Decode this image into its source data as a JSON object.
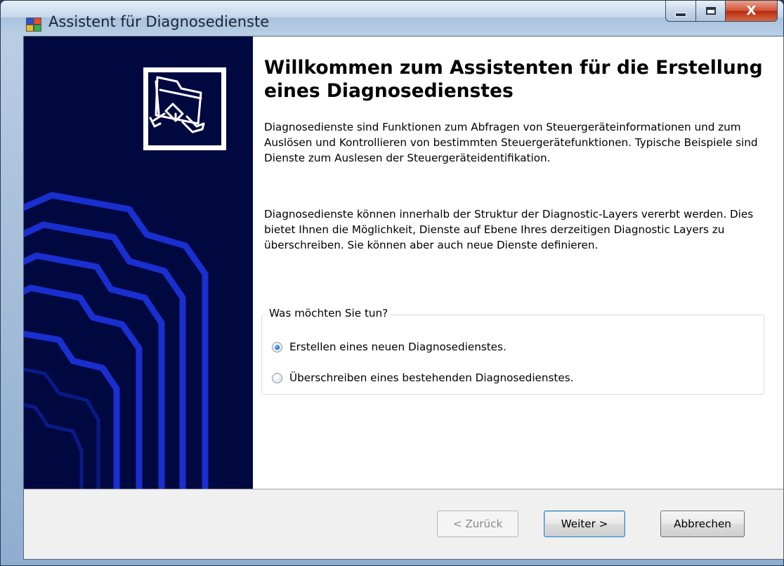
{
  "window": {
    "title": "Assistent für Diagnosedienste",
    "controls": {
      "minimize": "–",
      "maximize": "□",
      "close": "X"
    }
  },
  "banner": {
    "icon": "network-folder-icon",
    "accent_color": "#000840",
    "line_color": "#1a2fd0"
  },
  "content": {
    "heading": "Willkommen zum Assistenten für die Erstellung eines Diagnosedienstes",
    "paragraph1": "Diagnosedienste sind Funktionen zum Abfragen von Steuergeräteinformationen und zum Auslösen und Kontrollieren von bestimmten Steuergerätefunktionen. Typische Beispiele sind Dienste zum Auslesen der Steuergeräteidentifikation.",
    "paragraph2": "Diagnosedienste können innerhalb der Struktur der Diagnostic-Layers vererbt werden. Dies bietet Ihnen die Möglichkeit, Dienste auf Ebene Ihres derzeitigen Diagnostic Layers zu überschreiben. Sie können aber auch neue Dienste definieren.",
    "group": {
      "legend": "Was möchten Sie tun?",
      "options": [
        {
          "label": "Erstellen eines neuen Diagnosedienstes.",
          "selected": true
        },
        {
          "label": "Überschreiben eines bestehenden Diagnosedienstes.",
          "selected": false
        }
      ]
    }
  },
  "footer": {
    "back_label": "< Zurück",
    "back_enabled": false,
    "next_label": "Weiter >",
    "cancel_label": "Abbrechen"
  }
}
